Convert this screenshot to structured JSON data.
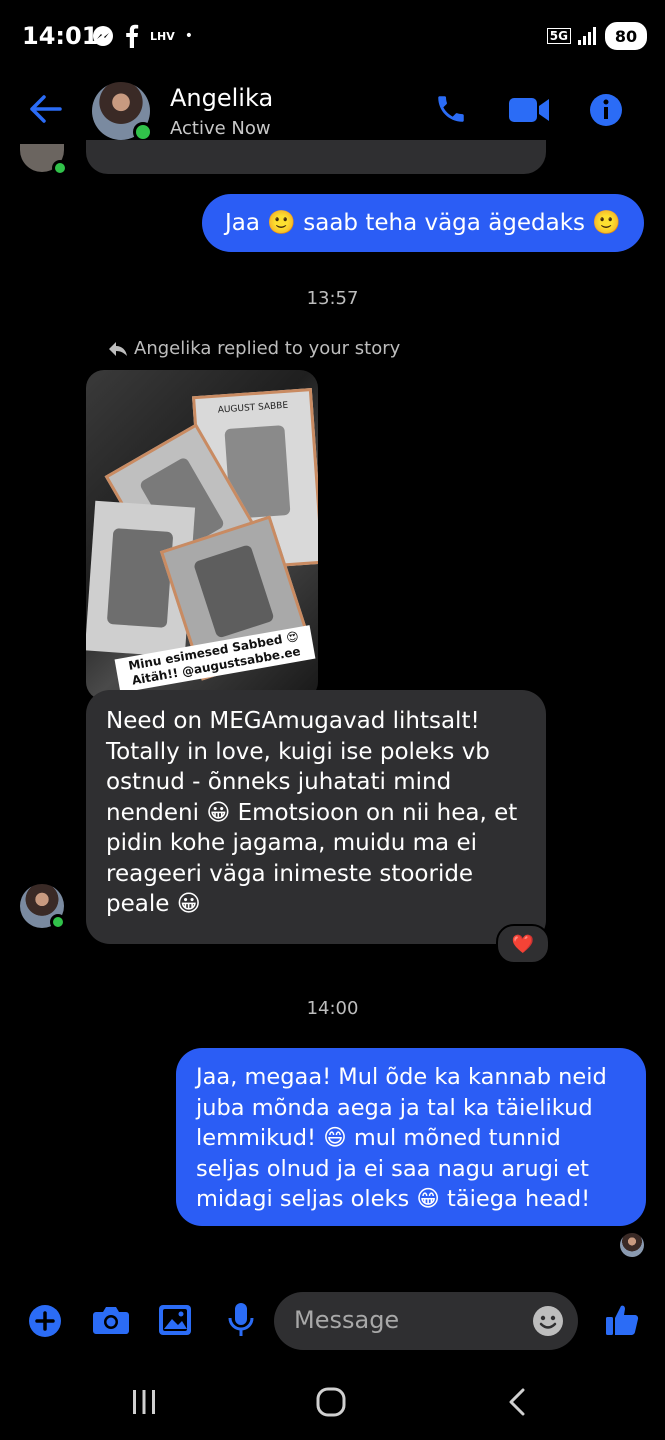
{
  "status_bar": {
    "time": "14:01",
    "carrier_label": "LHV",
    "network": "5G",
    "battery": "80"
  },
  "header": {
    "contact_name": "Angelika",
    "presence": "Active Now",
    "icons": [
      "back-arrow-icon",
      "phone-icon",
      "video-camera-icon",
      "info-icon"
    ],
    "accent_color": "#2b6cf6"
  },
  "messages": {
    "sent_1": "Jaa 🙂 saab teha väga ägedaks 🙂",
    "timestamp_1": "13:57",
    "story_reply_label": "Angelika replied to your story",
    "story_caption": "Minu esimesed Sabbed 😍 Aitäh!! @augustsabbe.ee",
    "story_brand": "AUGUST SABBE",
    "received_1": [
      "Need on MEGAmugavad lihtsalt!",
      "Totally in love, kuigi ise poleks vb",
      "ostnud - õnneks juhatati mind",
      "nendeni 😀 Emotsioon on nii hea, et",
      "pidin kohe jagama, muidu ma ei",
      "reageeri väga inimeste stooride",
      "peale 😀"
    ],
    "reaction": "❤️",
    "timestamp_2": "14:00",
    "sent_2": [
      "Jaa, megaa! Mul õde ka kannab neid",
      "juba mõnda aega ja tal ka täielikud",
      "lemmikud! 😄 mul mõned tunnid",
      "seljas olnud ja ei saa nagu arugi et",
      "midagi seljas oleks 😁 täiega head!"
    ]
  },
  "composer": {
    "placeholder": "Message",
    "icons": [
      "plus-icon",
      "camera-icon",
      "gallery-icon",
      "microphone-icon",
      "emoji-icon",
      "thumbs-up-icon"
    ]
  },
  "colors": {
    "sent_bubble": "#2b5df5",
    "received_bubble": "#2f2f31",
    "background": "#000000"
  }
}
